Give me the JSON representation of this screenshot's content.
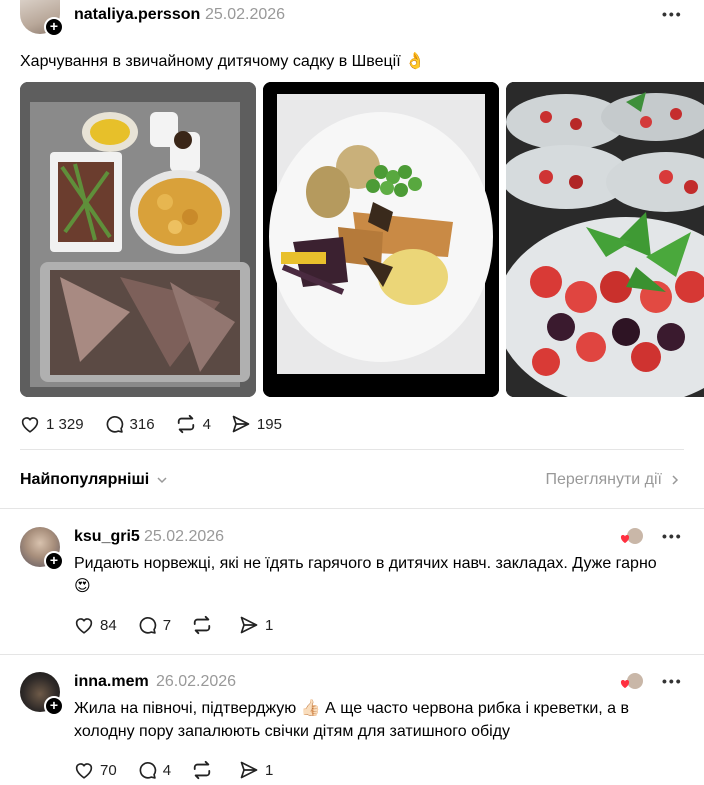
{
  "post": {
    "username": "nataliya.persson",
    "date": "25.02.2026",
    "text": "Харчування в звичайному дитячому садку в Швеції 👌",
    "likes": "1 329",
    "comments": "316",
    "reposts": "4",
    "shares": "195"
  },
  "replies_bar": {
    "sort_label": "Найпопулярніші",
    "activity_label": "Переглянути дії"
  },
  "comments": [
    {
      "username": "ksu_gri5",
      "date": "25.02.2026",
      "text": "Ридають норвежці, які не їдять гарячого в дитячих навч. закладах. Дуже гарно 😍",
      "likes": "84",
      "replies": "7",
      "shares": "1"
    },
    {
      "username": "inna.mem",
      "date": "26.02.2026",
      "text": "Жила на півночі, підтверджую 👍🏻 А ще часто червона рибка і креветки, а в холодну пору запалюють свічки дітям для затишного обіду",
      "likes": "70",
      "replies": "4",
      "shares": "1"
    }
  ]
}
